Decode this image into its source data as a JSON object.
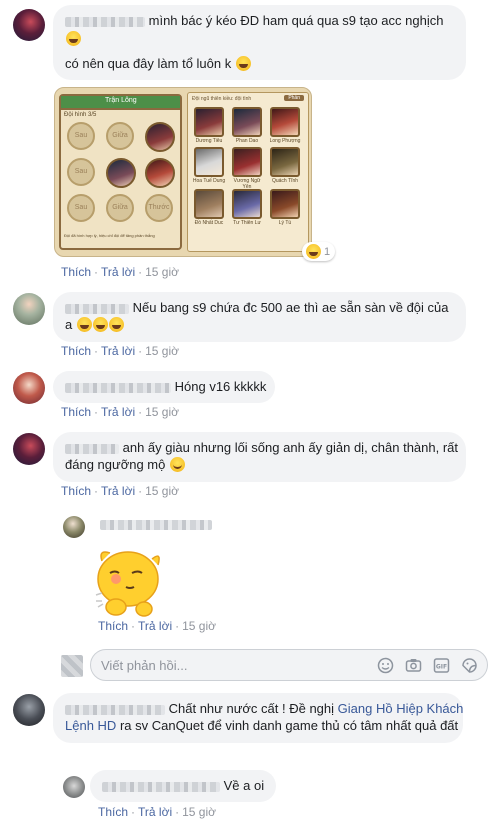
{
  "comments": [
    {
      "line1": "mình bác ý kéo ĐD ham quá qua s9 tạo acc nghịch",
      "line2": "có nên qua đây làm tổ luôn k",
      "actions": {
        "like": "Thích",
        "reply": "Trả lời",
        "time": "15 giờ"
      }
    },
    {
      "line1": "Nếu bang s9 chứa đc 500 ae thì ae sẵn sàn về đội của",
      "line2": "a",
      "actions": {
        "like": "Thích",
        "reply": "Trả lời",
        "time": "15 giờ"
      }
    },
    {
      "line1": "Hóng v16 kkkkk",
      "actions": {
        "like": "Thích",
        "reply": "Trả lời",
        "time": "15 giờ"
      }
    },
    {
      "line1": "anh ấy giàu nhưng lối sống anh ấy giản dị, chân thành, rất",
      "line2": "đáng ngưỡng mộ",
      "actions": {
        "like": "Thích",
        "reply": "Trả lời",
        "time": "15 giờ"
      }
    },
    {
      "actions": {
        "like": "Thích",
        "reply": "Trả lời",
        "time": "15 giờ"
      }
    },
    {
      "line1_a": "Chất như nước cất ! Đề nghị",
      "line1_link": "Giang Hồ Hiệp Khách",
      "line2_link": "Lệnh HD",
      "line2_b": "ra sv CanQuet để vinh danh game thủ có tâm nhất quả đất"
    },
    {
      "line1": "Về a oi",
      "actions": {
        "like": "Thích",
        "reply": "Trả lời",
        "time": "15 giờ"
      }
    }
  ],
  "reaction_count": "1",
  "reply_input": {
    "placeholder": "Viết phản hồi..."
  },
  "game": {
    "title": "Trận Lông",
    "header": "Đội ngũ thiên kiều: đội tình",
    "filter": "Phần",
    "team": "Đội hình 3/5",
    "slots": [
      "Sau",
      "Giữa",
      "Sau",
      "Sau",
      "Giữa",
      "Thước"
    ],
    "heroes": [
      "Dương Tiêu",
      "Phan Dao",
      "Long Phượng",
      "Hoa Tuế Dung",
      "Vương Ngữ Yên",
      "Quách Tĩnh",
      "Đồ Nhất Duc",
      "Tư Thiên Lư",
      "Lý Tú"
    ],
    "note": "Đội đã hình hợp lý, hiệu chỉ đội để tăng phân thắng"
  }
}
